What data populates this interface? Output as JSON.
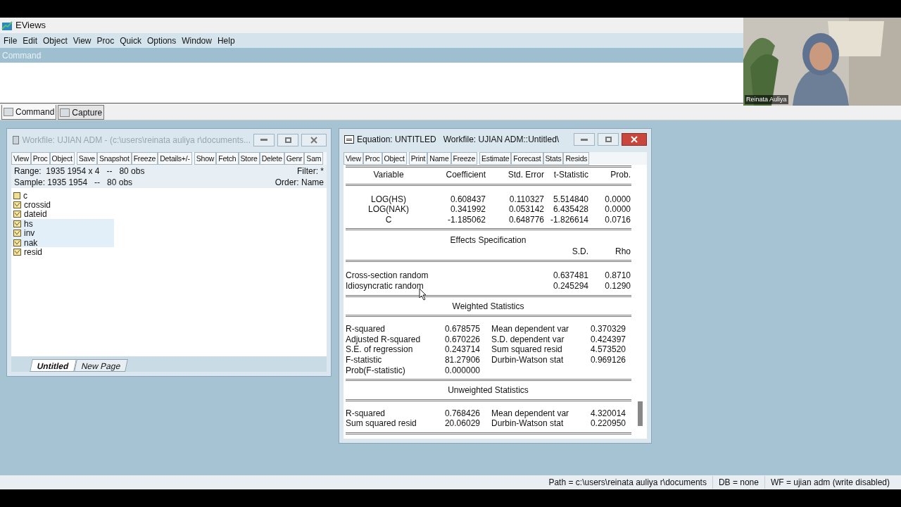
{
  "app": {
    "title": "EViews"
  },
  "menu": [
    "File",
    "Edit",
    "Object",
    "View",
    "Proc",
    "Quick",
    "Options",
    "Window",
    "Help"
  ],
  "command_pane": {
    "label": "Command"
  },
  "pane_tabs": [
    {
      "label": "Command",
      "selected": true
    },
    {
      "label": "Capture",
      "selected": false
    }
  ],
  "webcam": {
    "kind": "picture",
    "name": "Reinata Auliya"
  },
  "workfile_window": {
    "title": "Workfile: UJIAN ADM - (c:\\users\\reinata auliya r\\documents...",
    "active": false,
    "toolbar": [
      [
        "View",
        "Proc",
        "Object"
      ],
      [
        "Save",
        "Snapshot",
        "Freeze",
        "Details+/-"
      ],
      [
        "Show",
        "Fetch",
        "Store",
        "Delete",
        "Genr",
        "Sam"
      ]
    ],
    "range": "Range:  1935 1954 x 4   --   80 obs",
    "filter": "Filter: *",
    "sample": "Sample: 1935 1954   --   80 obs",
    "order": "Order: Name",
    "objects": [
      {
        "name": "c",
        "kind": "coef",
        "selected": false
      },
      {
        "name": "crossid",
        "kind": "series",
        "selected": false
      },
      {
        "name": "dateid",
        "kind": "series",
        "selected": false
      },
      {
        "name": "hs",
        "kind": "series",
        "selected": true
      },
      {
        "name": "inv",
        "kind": "series",
        "selected": true
      },
      {
        "name": "nak",
        "kind": "series",
        "selected": true
      },
      {
        "name": "resid",
        "kind": "series",
        "selected": false
      }
    ],
    "page_tabs": [
      {
        "label": "Untitled",
        "selected": true
      },
      {
        "label": "New Page",
        "selected": false
      }
    ]
  },
  "equation_window": {
    "title": "Equation: UNTITLED   Workfile: UJIAN ADM::Untitled\\",
    "active": true,
    "toolbar": [
      [
        "View",
        "Proc",
        "Object"
      ],
      [
        "Print",
        "Name",
        "Freeze"
      ],
      [
        "Estimate",
        "Forecast",
        "Stats",
        "Resids"
      ]
    ],
    "columns": [
      "Variable",
      "Coefficient",
      "Std. Error",
      "t-Statistic",
      "Prob."
    ],
    "coefficients": [
      [
        "LOG(HS)",
        "0.608437",
        "0.110327",
        "5.514840",
        "0.0000"
      ],
      [
        "LOG(NAK)",
        "0.341992",
        "0.053142",
        "6.435428",
        "0.0000"
      ],
      [
        "C",
        "-1.185062",
        "0.648776",
        "-1.826614",
        "0.0716"
      ]
    ],
    "effects": {
      "title": "Effects Specification",
      "columns": [
        "",
        "S.D.",
        "Rho"
      ],
      "rows": [
        [
          "Cross-section random",
          "0.637481",
          "0.8710"
        ],
        [
          "Idiosyncratic random",
          "0.245294",
          "0.1290"
        ]
      ]
    },
    "weighted": {
      "title": "Weighted Statistics",
      "rows": [
        [
          "R-squared",
          "0.678575",
          "Mean dependent var",
          "0.370329"
        ],
        [
          "Adjusted R-squared",
          "0.670226",
          "S.D. dependent var",
          "0.424397"
        ],
        [
          "S.E. of regression",
          "0.243714",
          "Sum squared resid",
          "4.573520"
        ],
        [
          "F-statistic",
          "81.27906",
          "Durbin-Watson stat",
          "0.969126"
        ],
        [
          "Prob(F-statistic)",
          "0.000000"
        ]
      ]
    },
    "unweighted": {
      "title": "Unweighted Statistics",
      "rows": [
        [
          "R-squared",
          "0.768426",
          "Mean dependent var",
          "4.320014"
        ],
        [
          "Sum squared resid",
          "20.06029",
          "Durbin-Watson stat",
          "0.220950"
        ]
      ]
    }
  },
  "status_bar": [
    "Path = c:\\users\\reinata auliya r\\documents",
    "DB = none",
    "WF = ujian adm (write disabled)"
  ]
}
